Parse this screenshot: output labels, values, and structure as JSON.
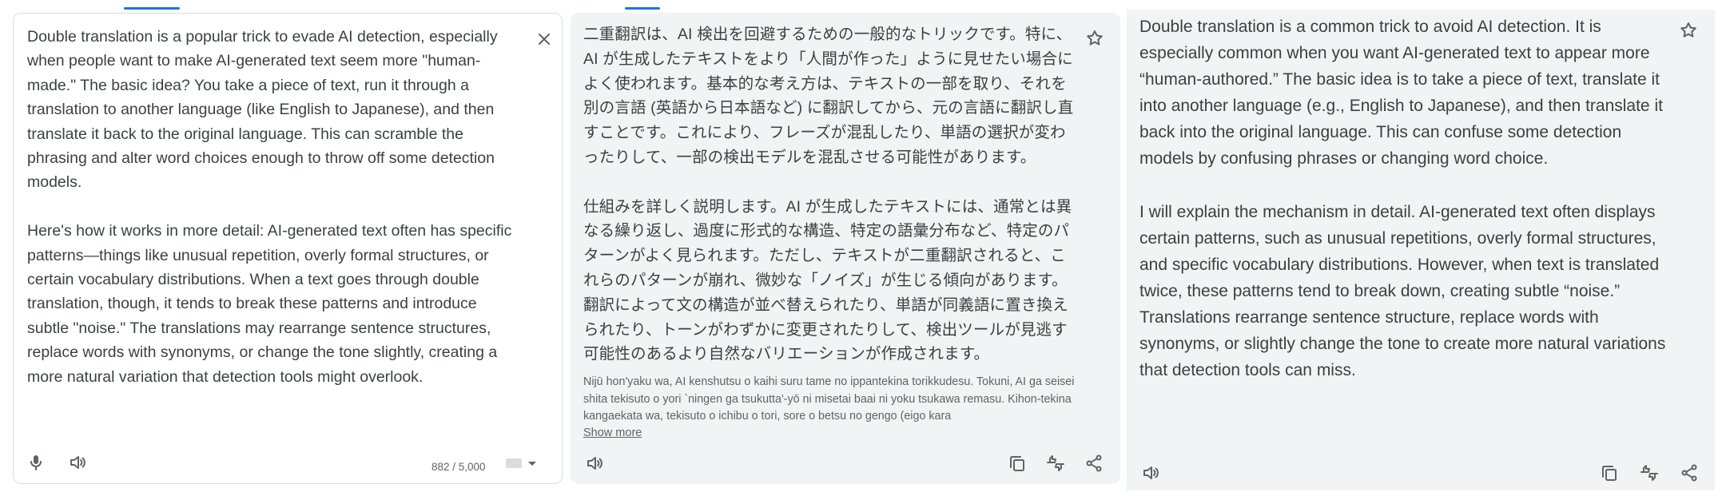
{
  "source_panel": {
    "text": "Double translation is a popular trick to evade AI detection, especially\nwhen people want to make AI-generated text seem more \"human-\nmade.\" The basic idea? You take a piece of text, run it through a\ntranslation to another language (like English to Japanese), and then\ntranslate it back to the original language. This can scramble the\nphrasing and alter word choices enough to throw off some detection\nmodels.\n\nHere's how it works in more detail: AI-generated text often has specific\npatterns—things like unusual repetition, overly formal structures, or\ncertain vocabulary distributions. When a text goes through double\ntranslation, though, it tends to break these patterns and introduce\nsubtle \"noise.\" The translations may rearrange sentence structures,\nreplace words with synonyms, or change the tone slightly, creating a\nmore natural variation that detection tools might overlook.",
    "char_count": "882 / 5,000",
    "icons": {
      "clear": "close-icon",
      "mic": "microphone-icon",
      "listen": "speaker-icon",
      "keyboard": "keyboard-icon"
    }
  },
  "translation_panel": {
    "text": "二重翻訳は、AI 検出を回避するための一般的なトリックです。特に、\nAI が生成したテキストをより「人間が作った」ように見せたい場合に\nよく使われます。基本的な考え方は、テキストの一部を取り、それを\n別の言語 (英語から日本語など) に翻訳してから、元の言語に翻訳し直\nすことです。これにより、フレーズが混乱したり、単語の選択が変わ\nったりして、一部の検出モデルを混乱させる可能性があります。\n\n仕組みを詳しく説明します。AI が生成したテキストには、通常とは異\nなる繰り返し、過度に形式的な構造、特定の語彙分布など、特定のパ\nターンがよく見られます。ただし、テキストが二重翻訳されると、こ\nれらのパターンが崩れ、微妙な「ノイズ」が生じる傾向があります。\n翻訳によって文の構造が並べ替えられたり、単語が同義語に置き換え\nられたり、トーンがわずかに変更されたりして、検出ツールが見逃す\n可能性のあるより自然なバリエーションが作成されます。",
    "transliteration": "Nijū hon'yaku wa, AI kenshutsu o kaihi suru tame no ippantekina torikkudesu. Tokuni, AI ga seisei shita tekisuto o yori `ningen ga tsukutta'-yō ni misetai baai ni yoku tsukawa remasu. Kihon-tekina kangaekata wa, tekisuto o ichibu o tori, sore o betsu no gengo (eigo kara",
    "show_more": "Show more",
    "icons": {
      "star": "star-icon",
      "listen": "speaker-icon",
      "copy": "copy-icon",
      "rate": "rate-translation-icon",
      "share": "share-icon"
    }
  },
  "back_translation_panel": {
    "text": "Double translation is a common trick to avoid AI detection. It is\nespecially common when you want AI-generated text to appear more\n“human-authored.” The basic idea is to take a piece of text, translate it\ninto another language (e.g., English to Japanese), and then translate it\nback into the original language. This can confuse some detection\nmodels by confusing phrases or changing word choice.\n\nI will explain the mechanism in detail. AI-generated text often displays\ncertain patterns, such as unusual repetitions, overly formal structures,\nand specific vocabulary distributions. However, when text is translated\ntwice, these patterns tend to break down, creating subtle “noise.”\nTranslations rearrange sentence structure, replace words with\nsynonyms, or slightly change the tone to create more natural variations\nthat detection tools can miss.",
    "icons": {
      "star": "star-icon",
      "listen": "speaker-icon",
      "copy": "copy-icon",
      "rate": "rate-translation-icon",
      "share": "share-icon"
    }
  },
  "colors": {
    "accent": "#1a73e8",
    "panel_bg": "#f1f3f4",
    "text": "#3c4043",
    "icon": "#5f6368",
    "border": "#dadce0"
  }
}
